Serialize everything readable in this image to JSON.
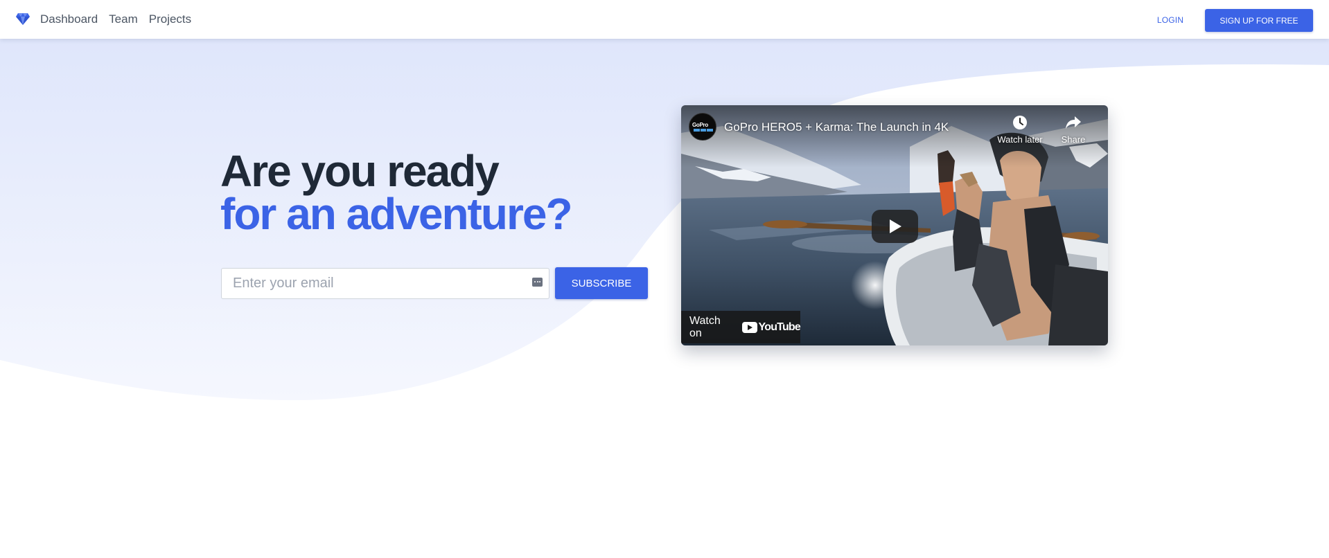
{
  "nav": {
    "links": [
      "Dashboard",
      "Team",
      "Projects"
    ],
    "login_label": "LOGIN",
    "signup_label": "SIGN UP FOR FREE",
    "logo_icon": "diamond-icon"
  },
  "hero": {
    "headline_line1": "Are you ready",
    "headline_line2": "for an adventure?",
    "email_placeholder": "Enter your email",
    "email_value": "",
    "subscribe_label": "SUBSCRIBE"
  },
  "video": {
    "title": "GoPro HERO5 + Karma: The Launch in 4K",
    "channel_logo_text": "GoPro",
    "watch_later_label": "Watch later",
    "share_label": "Share",
    "watch_on_label": "Watch on",
    "youtube_label": "YouTube"
  },
  "colors": {
    "accent": "#3b63e6",
    "heading": "#1f2937",
    "hero_background": "#e3e9fb"
  }
}
